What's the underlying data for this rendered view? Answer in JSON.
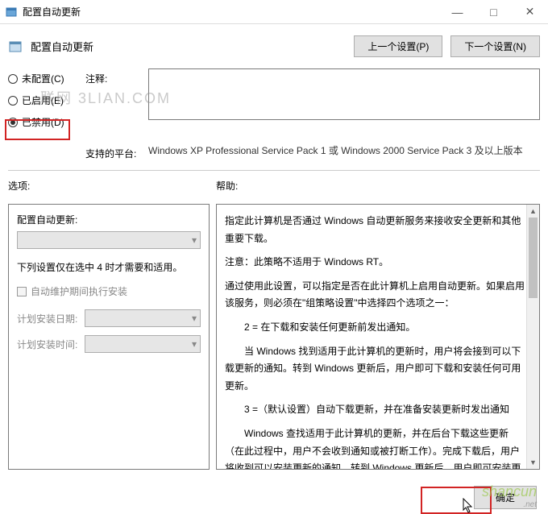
{
  "window": {
    "title": "配置自动更新",
    "minimize": "—",
    "maximize": "□",
    "close": "✕"
  },
  "header": {
    "title": "配置自动更新",
    "prev_btn": "上一个设置(P)",
    "next_btn": "下一个设置(N)"
  },
  "radios": {
    "not_configured": "未配置(C)",
    "enabled": "已启用(E)",
    "disabled": "已禁用(D)"
  },
  "comment": {
    "label": "注释:",
    "value": ""
  },
  "platform": {
    "label": "支持的平台:",
    "text": "Windows XP Professional Service Pack 1 或 Windows 2000 Service Pack 3 及以上版本"
  },
  "sections": {
    "options_label": "选项:",
    "help_label": "帮助:"
  },
  "options": {
    "config_label": "配置自动更新:",
    "note": "下列设置仅在选中 4 时才需要和适用。",
    "checkbox": "自动维护期间执行安装",
    "install_day_label": "计划安装日期:",
    "install_time_label": "计划安装时间:"
  },
  "help": {
    "p1": "指定此计算机是否通过 Windows 自动更新服务来接收安全更新和其他重要下载。",
    "p2": "注意：此策略不适用于 Windows RT。",
    "p3": "通过使用此设置，可以指定是否在此计算机上启用自动更新。如果启用该服务，则必须在\"组策略设置\"中选择四个选项之一：",
    "p4": "2 = 在下载和安装任何更新前发出通知。",
    "p5": "当 Windows 找到适用于此计算机的更新时，用户将会接到可以下载更新的通知。转到 Windows 更新后，用户即可下载和安装任何可用更新。",
    "p6": "3 =（默认设置）自动下载更新，并在准备安装更新时发出通知",
    "p7": "Windows 查找适用于此计算机的更新，并在后台下载这些更新（在此过程中，用户不会收到通知或被打断工作）。完成下载后，用户将收到可以安装更新的通知。转到 Windows 更新后，用户即可安装更新。"
  },
  "footer": {
    "ok": "确定"
  },
  "watermarks": {
    "w1": "联网 3LIAN.COM",
    "w2": "shancun",
    "w2_sub": ".net"
  }
}
